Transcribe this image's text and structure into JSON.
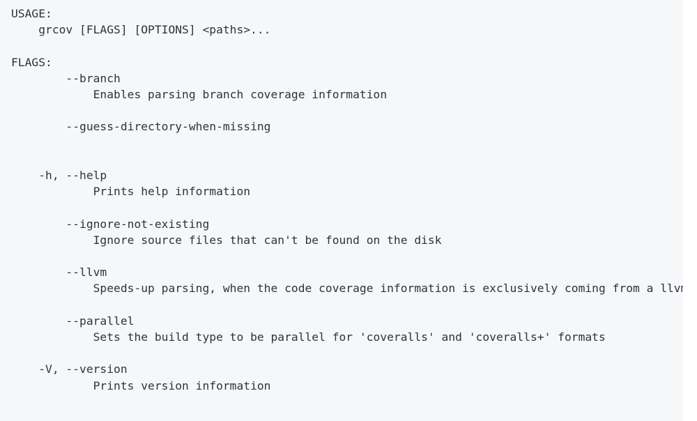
{
  "window": {
    "content_type": "terminal-help-output",
    "program": "grcov",
    "background_color": "#f6f7f9",
    "text_color": "#2f3338",
    "page_background_color": "#ffffff"
  },
  "help_output": {
    "sections": [
      {
        "heading": "USAGE:",
        "lines": [
          "    grcov [FLAGS] [OPTIONS] <paths>..."
        ]
      },
      {
        "heading": "FLAGS:",
        "lines": []
      }
    ],
    "flags": [
      {
        "name": "--branch",
        "short": "",
        "description": "Enables parsing branch coverage information"
      },
      {
        "name": "--guess-directory-when-missing",
        "short": "",
        "description": ""
      },
      {
        "name": "--help",
        "short": "-h",
        "description": "Prints help information"
      },
      {
        "name": "--ignore-not-existing",
        "short": "",
        "description": "Ignore source files that can't be found on the disk"
      },
      {
        "name": "--llvm",
        "short": "",
        "description": "Speeds-up parsing, when the code coverage information is exclusively coming from a llvm build"
      },
      {
        "name": "--parallel",
        "short": "",
        "description": "Sets the build type to be parallel for 'coveralls' and 'coveralls+' formats"
      },
      {
        "name": "--version",
        "short": "-V",
        "description": "Prints version information"
      }
    ],
    "raw_lines": [
      "USAGE:",
      "    grcov [FLAGS] [OPTIONS] <paths>...",
      "",
      "FLAGS:",
      "        --branch",
      "            Enables parsing branch coverage information",
      "",
      "        --guess-directory-when-missing",
      "",
      "",
      "    -h, --help",
      "            Prints help information",
      "",
      "        --ignore-not-existing",
      "            Ignore source files that can't be found on the disk",
      "",
      "        --llvm",
      "            Speeds-up parsing, when the code coverage information is exclusively coming from a llvm build",
      "",
      "        --parallel",
      "            Sets the build type to be parallel for 'coveralls' and 'coveralls+' formats",
      "",
      "    -V, --version",
      "            Prints version information"
    ]
  }
}
